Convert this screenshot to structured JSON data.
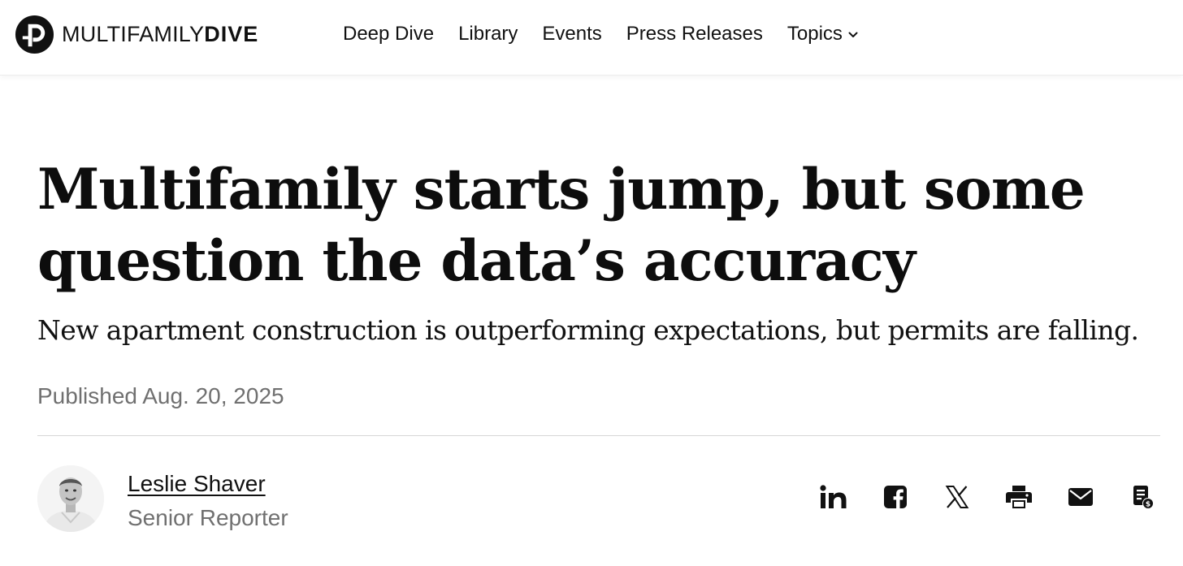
{
  "header": {
    "logo": {
      "icon": "multifamily-dive-logo-icon",
      "text_light": "MULTIFAMILY",
      "text_bold": "DIVE"
    },
    "nav": [
      {
        "label": "Deep Dive"
      },
      {
        "label": "Library"
      },
      {
        "label": "Events"
      },
      {
        "label": "Press Releases"
      },
      {
        "label": "Topics",
        "icon": "chevron-down-icon"
      }
    ]
  },
  "article": {
    "headline": "Multifamily starts jump, but some question the data’s accuracy",
    "dek": "New apartment construction is outperforming expectations, but permits are falling.",
    "published": "Published Aug. 20, 2025",
    "author": {
      "name": "Leslie Shaver",
      "role": "Senior Reporter",
      "avatar": "author-avatar"
    }
  },
  "share": {
    "icons": [
      "linkedin-icon",
      "facebook-icon",
      "x-icon",
      "print-icon",
      "email-icon",
      "license-icon"
    ]
  },
  "colors": {
    "text": "#111111",
    "muted": "#707070",
    "divider": "#d6d6d6"
  }
}
